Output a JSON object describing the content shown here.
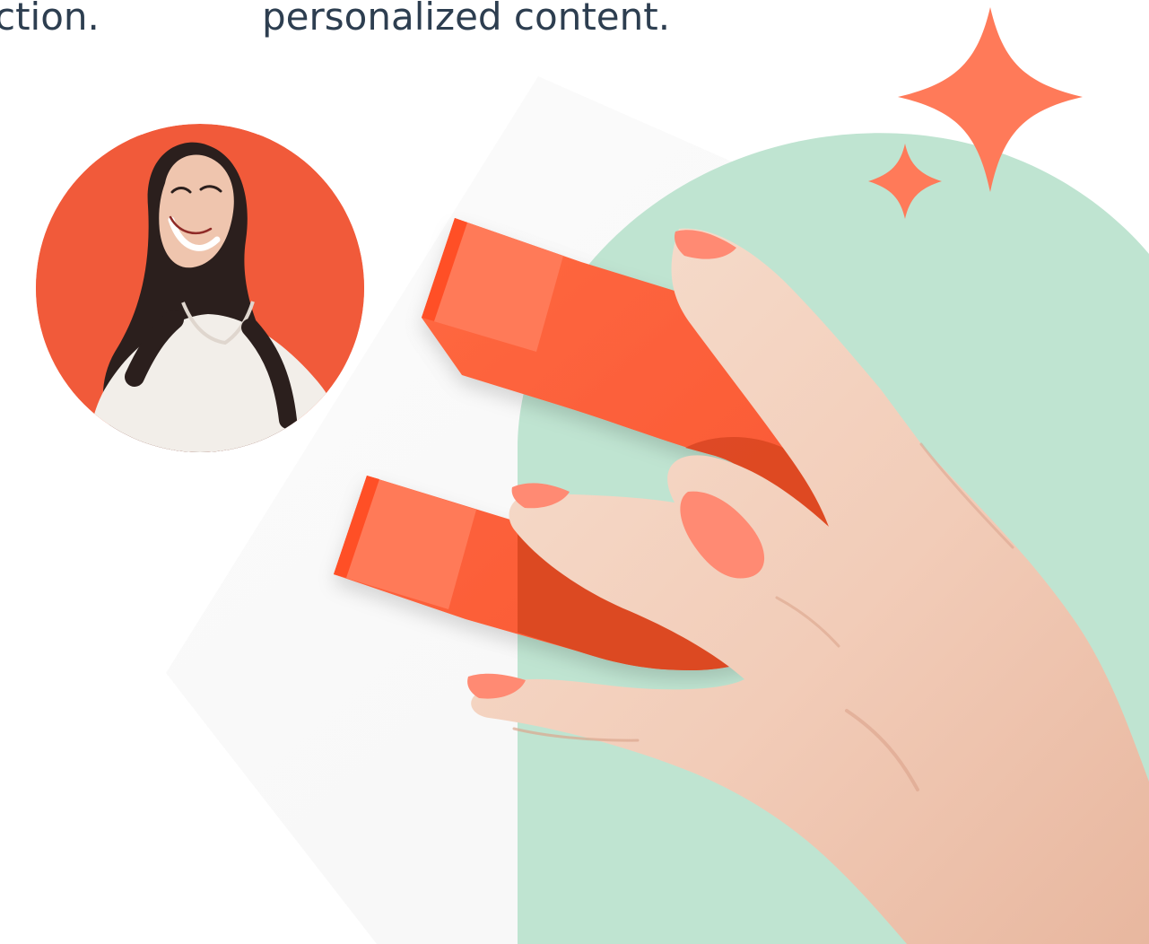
{
  "copy": {
    "left_fragment": "ction.",
    "right_fragment": "personalized content."
  },
  "icons": {
    "profile_image": "person-avatar",
    "magnet": "magnet-icon",
    "sparkle_large": "sparkle-icon",
    "sparkle_small": "sparkle-icon"
  },
  "colors": {
    "text": "#2d3e50",
    "accent": "#ff5c35",
    "accent_dark": "#d84722",
    "accent_light": "#ff7a59",
    "mint": "#bfe4d1",
    "background_panel": "#f8f8f8",
    "skin": "#f4d4c2",
    "nail": "#ff8a73",
    "hair": "#2b1f1d"
  }
}
